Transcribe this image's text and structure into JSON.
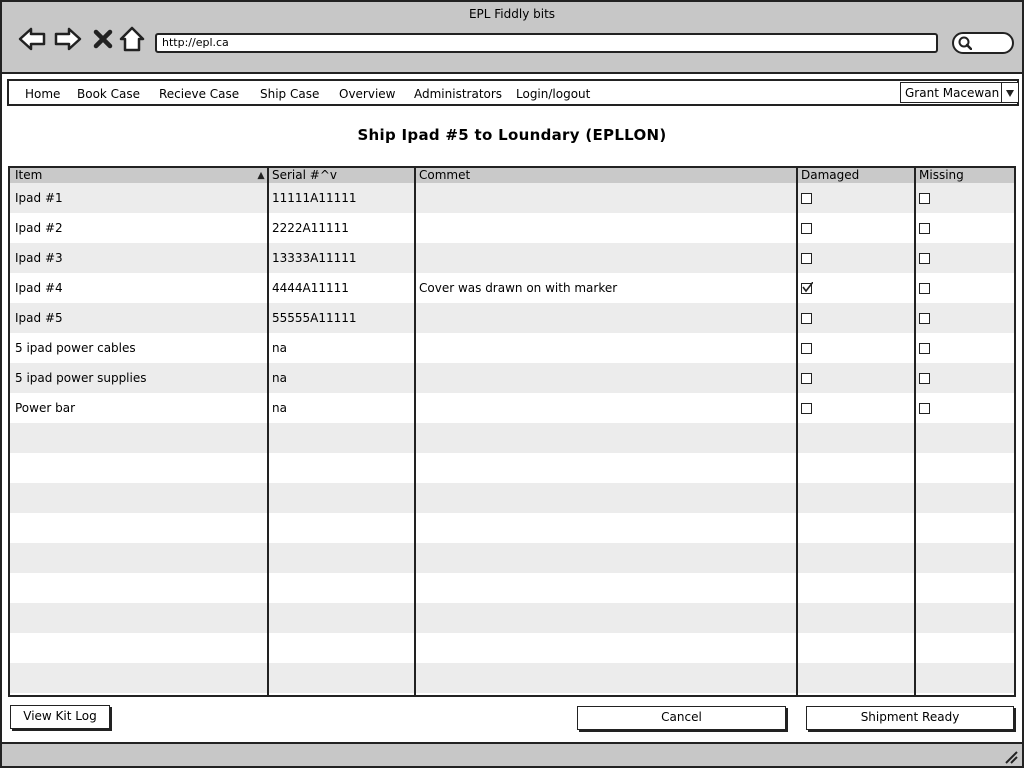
{
  "window": {
    "title": "EPL Fiddly bits"
  },
  "browser": {
    "url": "http://epl.ca"
  },
  "menu": {
    "items": [
      "Home",
      "Book Case",
      "Recieve Case",
      "Ship Case",
      "Overview",
      "Administrators",
      "Login/logout"
    ],
    "user": "Grant Macewan"
  },
  "page": {
    "title": "Ship Ipad #5 to Loundary (EPLLON)"
  },
  "table": {
    "headers": {
      "item": "Item",
      "serial": "Serial #^v",
      "comment": "Commet",
      "damaged": "Damaged",
      "missing": "Missing"
    },
    "sort_indicator": "ascending",
    "rows": [
      {
        "item": "Ipad #1",
        "serial": "11111A11111",
        "comment": "",
        "damaged": false,
        "missing": false
      },
      {
        "item": "Ipad #2",
        "serial": "2222A11111",
        "comment": "",
        "damaged": false,
        "missing": false
      },
      {
        "item": "Ipad #3",
        "serial": "13333A11111",
        "comment": "",
        "damaged": false,
        "missing": false
      },
      {
        "item": "Ipad #4",
        "serial": "4444A11111",
        "comment": "Cover was drawn on with marker",
        "damaged": true,
        "missing": false
      },
      {
        "item": "Ipad #5",
        "serial": "55555A11111",
        "comment": "",
        "damaged": false,
        "missing": false
      },
      {
        "item": "5 ipad power cables",
        "serial": "na",
        "comment": "",
        "damaged": false,
        "missing": false
      },
      {
        "item": "5 ipad power supplies",
        "serial": "na",
        "comment": "",
        "damaged": false,
        "missing": false
      },
      {
        "item": "Power bar",
        "serial": "na",
        "comment": "",
        "damaged": false,
        "missing": false
      }
    ]
  },
  "buttons": {
    "view_kit_log": "View Kit Log",
    "cancel": "Cancel",
    "shipment_ready": "Shipment Ready"
  },
  "icons": {
    "back": "back-arrow-icon",
    "forward": "forward-arrow-icon",
    "stop": "close-icon",
    "home": "home-icon",
    "search": "search-icon",
    "dropdown": "triangle-down-icon",
    "sort": "triangle-up-icon",
    "check": "checkmark-icon",
    "resize": "resize-grip-icon"
  }
}
